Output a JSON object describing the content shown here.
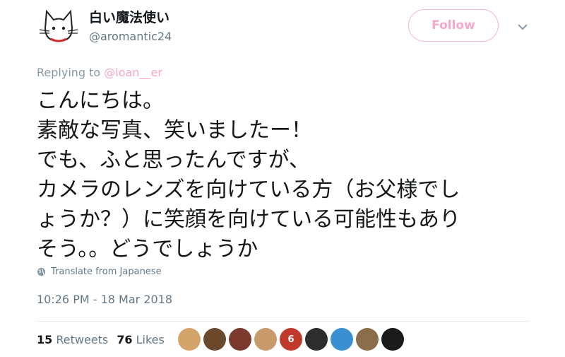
{
  "user": {
    "display_name": "白い魔法使い",
    "handle": "@aromantic24",
    "avatar_icon": "white-cat-icon"
  },
  "follow_label": "Follow",
  "reply": {
    "prefix": "Replying to ",
    "mention": "@loan__er"
  },
  "tweet": {
    "lines": [
      "こんにちは。",
      "素敵な写真、笑いましたー！",
      "でも、ふと思ったんですが、",
      "カメラのレンズを向けている方（お父様でし",
      "ょうか？）に笑顔を向けている可能性もあり",
      "そう。。どうでしょうか"
    ]
  },
  "translate_label": "Translate from Japanese",
  "timestamp": "10:26 PM - 18 Mar 2018",
  "stats": {
    "retweets_count": "15",
    "retweets_label": "Retweets",
    "likes_count": "76",
    "likes_label": "Likes"
  },
  "likers": [
    {
      "color": "#d4a56a",
      "glyph": ""
    },
    {
      "color": "#6b4a2b",
      "glyph": ""
    },
    {
      "color": "#7a3b2e",
      "glyph": ""
    },
    {
      "color": "#c89a6b",
      "glyph": ""
    },
    {
      "color": "#c0392b",
      "glyph": "6"
    },
    {
      "color": "#2d2d2d",
      "glyph": ""
    },
    {
      "color": "#3a8fd1",
      "glyph": ""
    },
    {
      "color": "#8a6d4a",
      "glyph": ""
    },
    {
      "color": "#1a1a1a",
      "glyph": ""
    }
  ],
  "colors": {
    "accent_pink": "#f7a6c6",
    "muted": "#657786"
  }
}
